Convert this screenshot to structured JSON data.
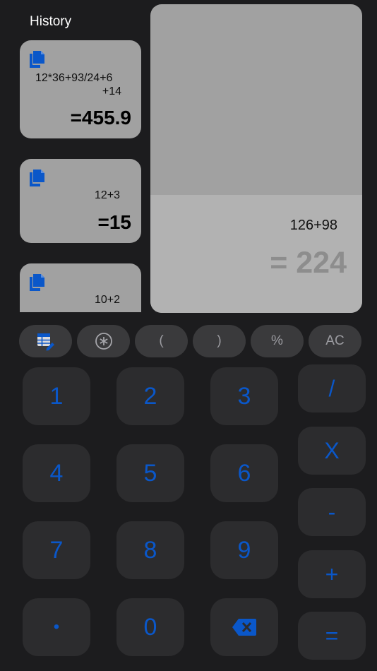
{
  "history": {
    "title": "History",
    "items": [
      {
        "expr_line1": "12*36+93/24+6",
        "expr_line2": "+14",
        "result": "=455.9"
      },
      {
        "expr_line1": "12+3",
        "result": "=15"
      },
      {
        "expr_line1": "10+2"
      }
    ]
  },
  "display": {
    "expression": "126+98",
    "result": "= 224"
  },
  "function_row": {
    "table_icon": "table-edit-icon",
    "asterisk_icon": "asterisk-icon",
    "open_paren": "(",
    "close_paren": ")",
    "percent": "%",
    "clear": "AC"
  },
  "keypad": {
    "k1": "1",
    "k2": "2",
    "k3": "3",
    "k4": "4",
    "k5": "5",
    "k6": "6",
    "k7": "7",
    "k8": "8",
    "k9": "9",
    "dot": "•",
    "k0": "0",
    "backspace_icon": "backspace-icon"
  },
  "operators": {
    "divide": "/",
    "multiply": "X",
    "minus": "-",
    "plus": "+",
    "equals": "="
  },
  "colors": {
    "background": "#1c1c1e",
    "accent_blue": "#0a57c9",
    "card_gray": "#a1a1a1",
    "key_gray": "#2c2c2e"
  }
}
